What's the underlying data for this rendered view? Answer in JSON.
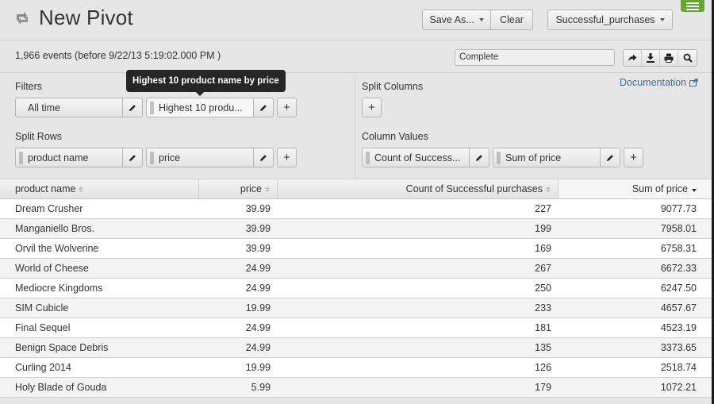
{
  "header": {
    "title": "New Pivot",
    "save_as_label": "Save As...",
    "clear_label": "Clear",
    "dataset_label": "Successful_purchases"
  },
  "status": {
    "event_count": "1,966 events (before 9/22/13 5:19:02.000 PM )",
    "job_status": "Complete",
    "actions": [
      "share-icon",
      "export-icon",
      "print-icon",
      "inspect-icon"
    ]
  },
  "config": {
    "filters": {
      "label": "Filters",
      "items": [
        "All time",
        "Highest 10 produ..."
      ]
    },
    "split_rows": {
      "label": "Split Rows",
      "items": [
        "product name",
        "price"
      ]
    },
    "split_columns": {
      "label": "Split Columns"
    },
    "column_values": {
      "label": "Column Values",
      "items": [
        "Count of Success...",
        "Sum of price"
      ]
    },
    "documentation_label": "Documentation",
    "add_label": "+",
    "tooltip": "Highest 10 product name by price"
  },
  "table": {
    "columns": [
      "product name",
      "price",
      "Count of Successful purchases",
      "Sum of price"
    ],
    "sorted_column": "Sum of price",
    "sort_direction": "descending",
    "rows": [
      [
        "Dream Crusher",
        "39.99",
        "227",
        "9077.73"
      ],
      [
        "Manganiello Bros.",
        "39.99",
        "199",
        "7958.01"
      ],
      [
        "Orvil the Wolverine",
        "39.99",
        "169",
        "6758.31"
      ],
      [
        "World of Cheese",
        "24.99",
        "267",
        "6672.33"
      ],
      [
        "Mediocre Kingdoms",
        "24.99",
        "250",
        "6247.50"
      ],
      [
        "SIM Cubicle",
        "19.99",
        "233",
        "4657.67"
      ],
      [
        "Final Sequel",
        "24.99",
        "181",
        "4523.19"
      ],
      [
        "Benign Space Debris",
        "24.99",
        "135",
        "3373.65"
      ],
      [
        "Curling 2014",
        "19.99",
        "126",
        "2518.74"
      ],
      [
        "Holy Blade of Gouda",
        "5.99",
        "179",
        "1072.21"
      ]
    ]
  },
  "colors": {
    "accent_green": "#65a637",
    "link_blue": "#3a6ea5",
    "tooltip_bg": "#262626"
  }
}
